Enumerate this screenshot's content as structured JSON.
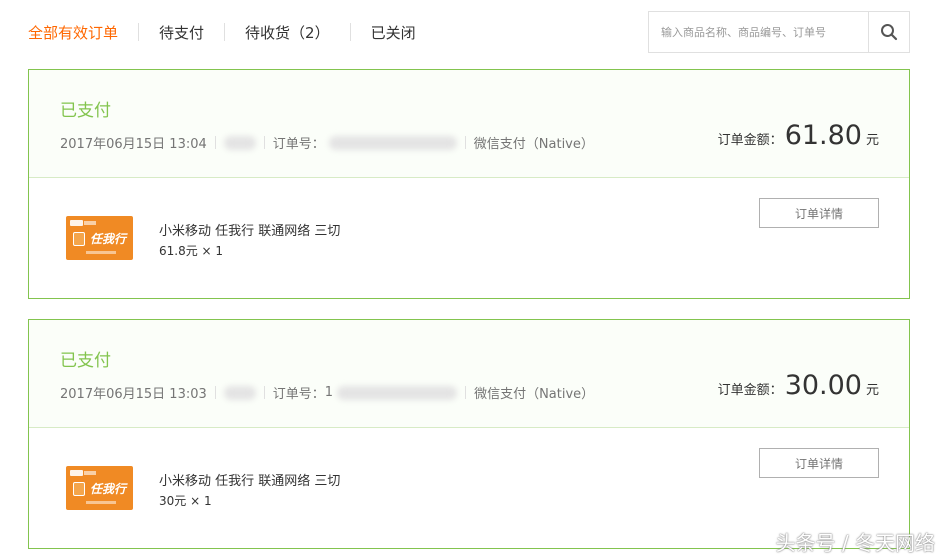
{
  "tabs": [
    {
      "label": "全部有效订单",
      "active": true
    },
    {
      "label": "待支付",
      "active": false
    },
    {
      "label": "待收货（2）",
      "active": false
    },
    {
      "label": "已关闭",
      "active": false
    }
  ],
  "search": {
    "placeholder": "输入商品名称、商品编号、订单号",
    "icon": "search-icon"
  },
  "orders": [
    {
      "status": "已支付",
      "datetime": "2017年06月15日 13:04",
      "order_no_label": "订单号：",
      "order_no_visible": "",
      "payment": "微信支付（Native）",
      "amount_label": "订单金额：",
      "amount": "61.80",
      "unit": "元",
      "product_name": "小米移动 任我行 联通网络 三切",
      "product_price": "61.8元 × 1",
      "detail_button": "订单详情",
      "thumb_text": "任我行"
    },
    {
      "status": "已支付",
      "datetime": "2017年06月15日 13:03",
      "order_no_label": "订单号：",
      "order_no_visible": "1",
      "payment": "微信支付（Native）",
      "amount_label": "订单金额：",
      "amount": "30.00",
      "unit": "元",
      "product_name": "小米移动 任我行 联通网络 三切",
      "product_price": "30元 × 1",
      "detail_button": "订单详情",
      "thumb_text": "任我行"
    }
  ],
  "watermark": "头条号 / 冬天网络",
  "colors": {
    "accent": "#ff6700",
    "paid_green": "#83c44e",
    "border_green": "#83c44e"
  }
}
